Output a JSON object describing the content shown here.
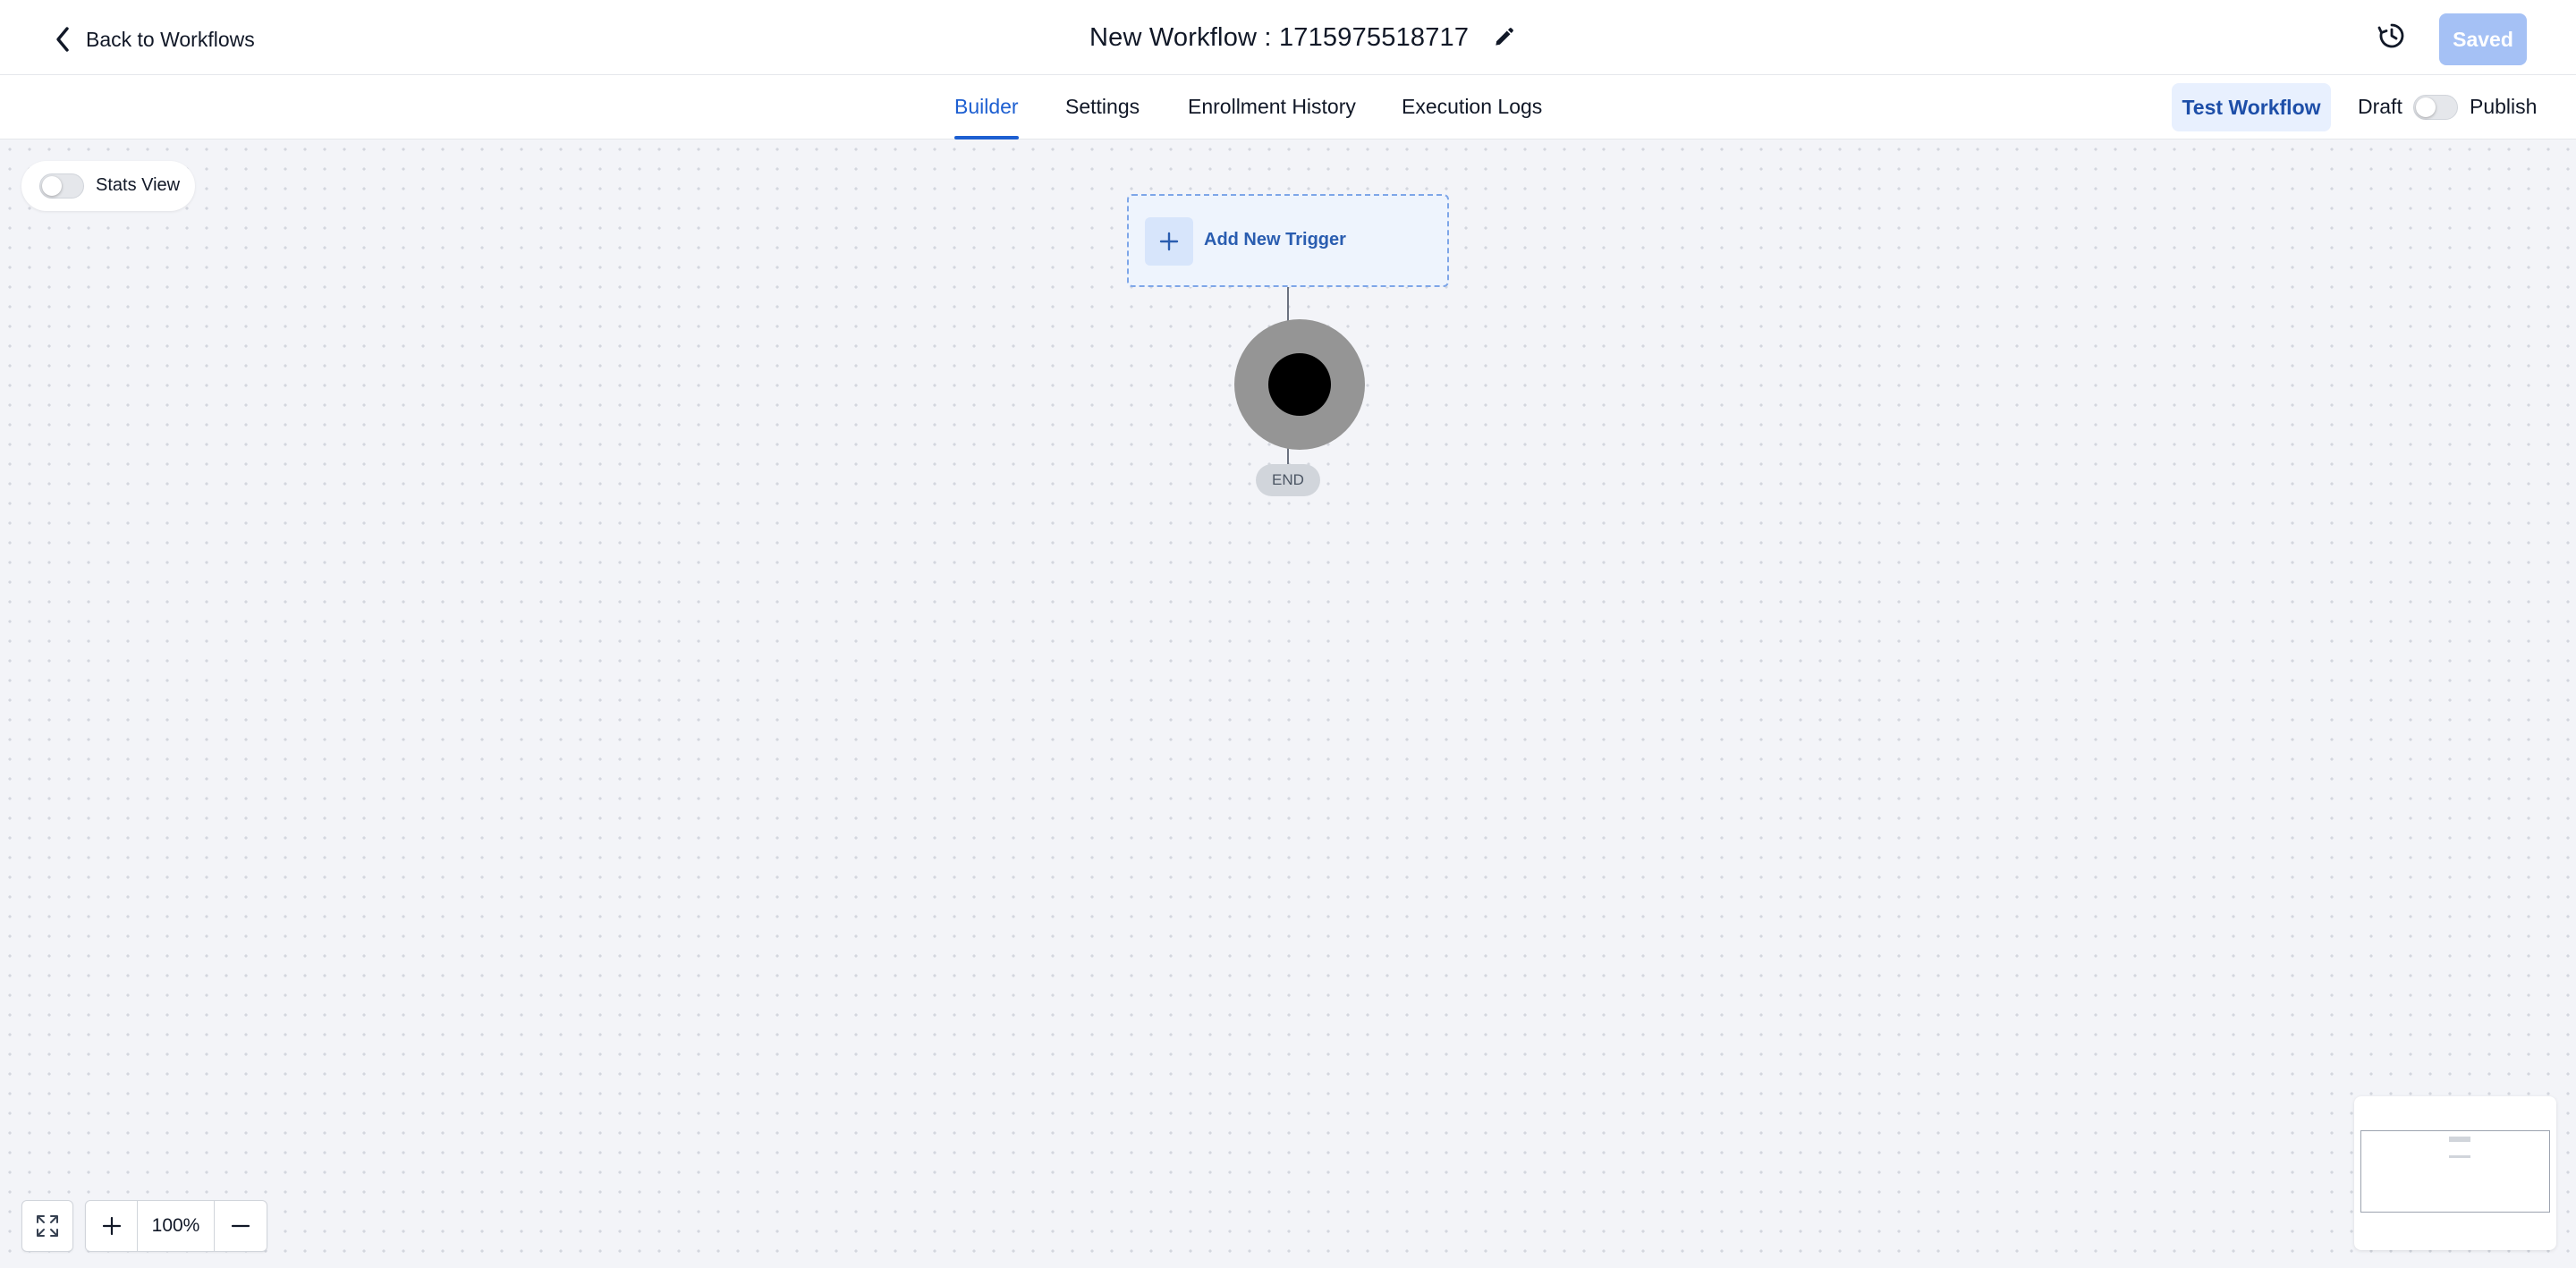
{
  "header": {
    "back_label": "Back to Workflows",
    "title": "New Workflow : 1715975518717",
    "saved_label": "Saved"
  },
  "tabs": [
    {
      "label": "Builder",
      "active": true
    },
    {
      "label": "Settings",
      "active": false
    },
    {
      "label": "Enrollment History",
      "active": false
    },
    {
      "label": "Execution Logs",
      "active": false
    }
  ],
  "actions": {
    "test_label": "Test Workflow",
    "draft_label": "Draft",
    "publish_label": "Publish",
    "publish_on": false
  },
  "canvas": {
    "stats_label": "Stats View",
    "stats_on": false,
    "trigger_label": "Add New Trigger",
    "end_label": "END",
    "zoom_level": "100%"
  },
  "icons": [
    "chevron-left-icon",
    "pencil-icon",
    "history-icon",
    "plus-icon",
    "fit-view-icon",
    "minus-icon"
  ],
  "colors": {
    "accent": "#1d5fd1",
    "saved_button": "#a5c1f5",
    "canvas_bg": "#f3f4f8",
    "trigger_bg": "#eef4fd"
  }
}
